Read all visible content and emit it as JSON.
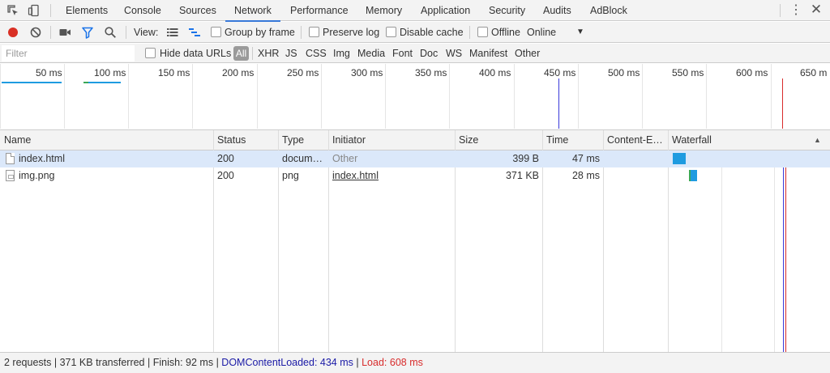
{
  "tabs": [
    {
      "label": "Elements"
    },
    {
      "label": "Console"
    },
    {
      "label": "Sources"
    },
    {
      "label": "Network",
      "active": true
    },
    {
      "label": "Performance"
    },
    {
      "label": "Memory"
    },
    {
      "label": "Application"
    },
    {
      "label": "Security"
    },
    {
      "label": "Audits"
    },
    {
      "label": "AdBlock"
    }
  ],
  "toolbar": {
    "view_label": "View:",
    "group_by_frame": "Group by frame",
    "preserve_log": "Preserve log",
    "disable_cache": "Disable cache",
    "offline": "Offline",
    "throttling": "Online"
  },
  "filterbar": {
    "placeholder": "Filter",
    "hide_data_urls": "Hide data URLs",
    "types": [
      "All",
      "XHR",
      "JS",
      "CSS",
      "Img",
      "Media",
      "Font",
      "Doc",
      "WS",
      "Manifest",
      "Other"
    ],
    "active_type": "All"
  },
  "overview": {
    "ticks": [
      "50 ms",
      "100 ms",
      "150 ms",
      "200 ms",
      "250 ms",
      "300 ms",
      "350 ms",
      "400 ms",
      "450 ms",
      "500 ms",
      "550 ms",
      "600 ms",
      "650 m"
    ],
    "dom_content_loaded_color": "#3a3ad9",
    "load_color": "#d82c2c"
  },
  "columns": [
    "Name",
    "Status",
    "Type",
    "Initiator",
    "Size",
    "Time",
    "Content-E…",
    "Waterfall"
  ],
  "rows": [
    {
      "name": "index.html",
      "status": "200",
      "type": "docum…",
      "initiator": "Other",
      "size": "399 B",
      "time": "47 ms",
      "content_encoding": "",
      "selected": true
    },
    {
      "name": "img.png",
      "status": "200",
      "type": "png",
      "initiator": "index.html",
      "size": "371 KB",
      "time": "28 ms",
      "content_encoding": "",
      "selected": false
    }
  ],
  "status": {
    "requests": "2 requests",
    "transferred": "371 KB transferred",
    "finish": "Finish: 92 ms",
    "dom_content_loaded": "DOMContentLoaded: 434 ms",
    "load": "Load: 608 ms"
  },
  "colors": {
    "accent": "#3879d9",
    "record": "#d93025",
    "selected_row": "#dbe8fa",
    "waterfall_bar": "#1f9be0",
    "waterfall_wait": "#3aa757"
  }
}
